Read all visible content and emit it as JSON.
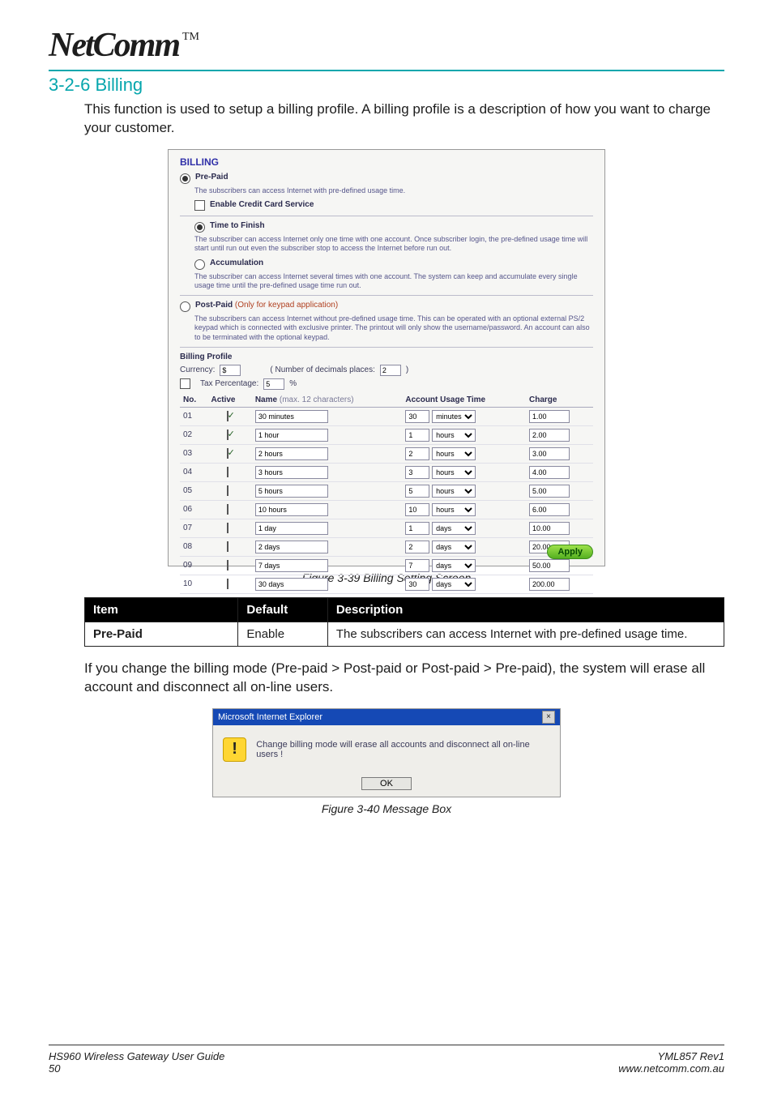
{
  "logo": {
    "text": "NetComm",
    "tm": "TM"
  },
  "section": {
    "number_title": "3-2-6 Billing",
    "intro": "This function is used to setup a billing profile. A billing profile is a description of how you want to charge your customer."
  },
  "figure_billing_caption": "Figure 3-39 Billing Setting Screen",
  "figure_dialog_caption": "Figure 3-40 Message Box",
  "meta_table": {
    "headers": [
      "Item",
      "Default",
      "Description"
    ],
    "row": {
      "item": "Pre-Paid",
      "default": "Enable",
      "desc": "The subscribers can access Internet with pre-defined usage time."
    }
  },
  "mode_note": "If you change the billing mode (Pre-paid > Post-paid or Post-paid > Pre-paid), the system will erase all account and disconnect all on-line users.",
  "footer": {
    "left_line1": "HS960 Wireless Gateway User Guide",
    "left_line2": "50",
    "right_line1": "YML857 Rev1",
    "right_line2": "www.netcomm.com.au"
  },
  "billing_panel": {
    "title": "BILLING",
    "prepaid": {
      "label": "Pre-Paid",
      "desc": "The subscribers can access Internet with pre-defined usage time.",
      "credit_card": "Enable Credit Card Service",
      "ttf": {
        "label": "Time to Finish",
        "desc": "The subscriber can access Internet only one time with one account.  Once subscriber login, the pre-defined usage time will start until run out even the subscriber stop to access the Internet before run out."
      },
      "acc": {
        "label": "Accumulation",
        "desc": "The subscriber can access Internet several times with one account.  The system can keep and accumulate every single usage time until the pre-defined usage time run out."
      }
    },
    "postpaid": {
      "label": "Post-Paid",
      "note_suffix": "(Only for keypad application)",
      "desc": "The subscribers can access Internet without pre-defined usage time. This can be operated with an optional external PS/2 keypad which is connected with exclusive printer. The printout will only show the username/password. An account can also to be terminated with the optional keypad."
    },
    "profile_label": "Billing Profile",
    "currency": {
      "label": "Currency:",
      "value": "$",
      "dec_label": "( Number of decimals places:",
      "dec_value": "2",
      "dec_close": ")"
    },
    "tax": {
      "label": "Tax Percentage:",
      "value": "5",
      "unit": "%"
    },
    "columns": {
      "no": "No.",
      "active": "Active",
      "name": "Name",
      "name_hint": "(max. 12 characters)",
      "usage": "Account Usage Time",
      "charge": "Charge"
    },
    "unit_options": [
      "minutes",
      "hours",
      "days"
    ],
    "rows": [
      {
        "no": "01",
        "active": true,
        "name": "30 minutes",
        "qty": "30",
        "unit": "minutes",
        "charge": "1.00"
      },
      {
        "no": "02",
        "active": true,
        "name": "1 hour",
        "qty": "1",
        "unit": "hours",
        "charge": "2.00"
      },
      {
        "no": "03",
        "active": true,
        "name": "2 hours",
        "qty": "2",
        "unit": "hours",
        "charge": "3.00"
      },
      {
        "no": "04",
        "active": false,
        "name": "3 hours",
        "qty": "3",
        "unit": "hours",
        "charge": "4.00"
      },
      {
        "no": "05",
        "active": false,
        "name": "5 hours",
        "qty": "5",
        "unit": "hours",
        "charge": "5.00"
      },
      {
        "no": "06",
        "active": false,
        "name": "10 hours",
        "qty": "10",
        "unit": "hours",
        "charge": "6.00"
      },
      {
        "no": "07",
        "active": false,
        "name": "1 day",
        "qty": "1",
        "unit": "days",
        "charge": "10.00"
      },
      {
        "no": "08",
        "active": false,
        "name": "2 days",
        "qty": "2",
        "unit": "days",
        "charge": "20.00"
      },
      {
        "no": "09",
        "active": false,
        "name": "7 days",
        "qty": "7",
        "unit": "days",
        "charge": "50.00"
      },
      {
        "no": "10",
        "active": false,
        "name": "30 days",
        "qty": "30",
        "unit": "days",
        "charge": "200.00"
      }
    ],
    "apply": "Apply"
  },
  "dialog": {
    "title": "Microsoft Internet Explorer",
    "close": "×",
    "msg": "Change billing mode will erase all accounts and disconnect all on-line users !",
    "ok": "OK"
  }
}
